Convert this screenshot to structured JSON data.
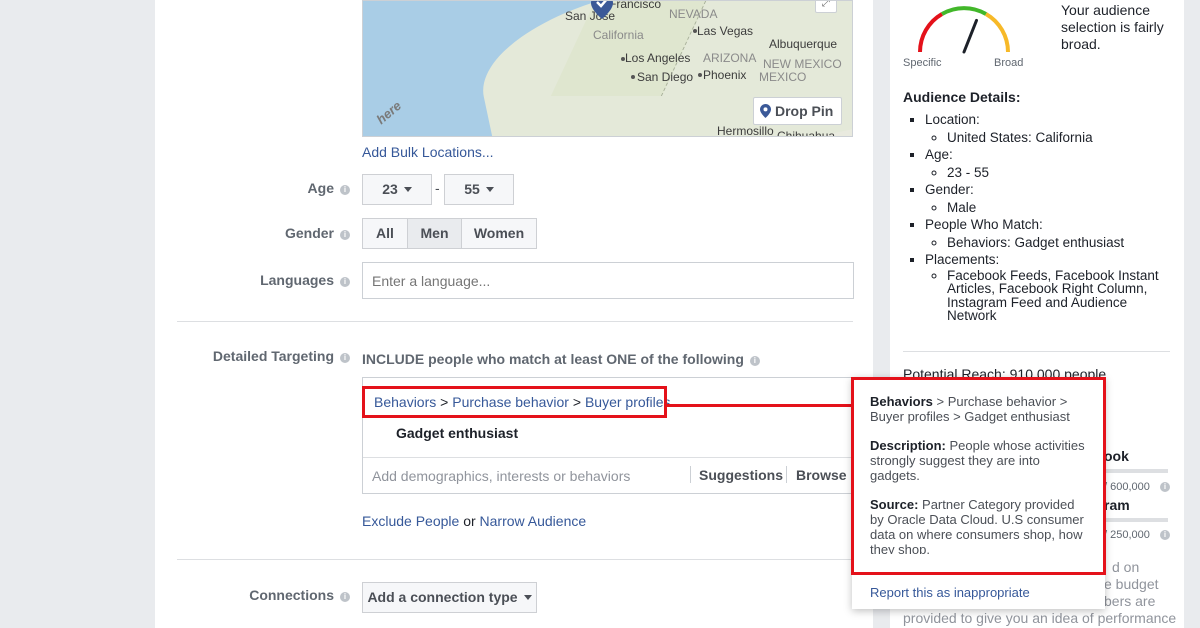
{
  "map": {
    "labels": {
      "san_jose": "San Jose",
      "francisco": "Francisco",
      "nevada": "NEVADA",
      "las_vegas": "Las Vegas",
      "california": "California",
      "arizona": "ARIZONA",
      "los_angeles": "Los Angeles",
      "albuquerque": "Albuquerque",
      "new_mexico": "NEW MEXICO",
      "san_diego": "San Diego",
      "phoenix": "Phoenix",
      "mexico": "MEXICO",
      "hermosillo": "Hermosillo",
      "chihuahua": "Chihuahua",
      "here": "here"
    },
    "drop_pin": "Drop Pin"
  },
  "add_bulk_locations": "Add Bulk Locations...",
  "age": {
    "label": "Age",
    "min": "23",
    "separator": "-",
    "max": "55"
  },
  "gender": {
    "label": "Gender",
    "options": [
      "All",
      "Men",
      "Women"
    ],
    "selected": "Men"
  },
  "languages": {
    "label": "Languages",
    "placeholder": "Enter a language..."
  },
  "detailed_targeting": {
    "label": "Detailed Targeting",
    "include_text": "INCLUDE people who match at least ONE of the following",
    "breadcrumb": [
      "Behaviors",
      "Purchase behavior",
      "Buyer profiles"
    ],
    "breadcrumb_sep": ">",
    "selected_item": "Gadget enthusiast",
    "search_placeholder": "Add demographics, interests or behaviors",
    "suggestions": "Suggestions",
    "browse": "Browse",
    "exclude": "Exclude People",
    "or": "or",
    "narrow": "Narrow Audience"
  },
  "connections": {
    "label": "Connections",
    "button": "Add a connection type"
  },
  "tooltip": {
    "path_bold": "Behaviors",
    "path_rest": " > Purchase behavior > Buyer profiles > Gadget enthusiast",
    "desc_label": "Description:",
    "desc_text": " People whose activities strongly suggest they are into gadgets.",
    "source_label": "Source:",
    "source_text": " Partner Category provided by Oracle Data Cloud. U.S consumer data on where consumers shop, how they shop.",
    "report": "Report this as inappropriate"
  },
  "audience": {
    "gauge_specific": "Specific",
    "gauge_broad": "Broad",
    "gauge_level": 0.62,
    "gauge_colors": [
      "#e4111a",
      "#f7b928",
      "#42b72a"
    ],
    "message": "Your audience selection is fairly broad.",
    "details_title": "Audience Details:",
    "details": [
      {
        "label": "Location:",
        "items": [
          "United States: California"
        ]
      },
      {
        "label": "Age:",
        "items": [
          "23 - 55"
        ]
      },
      {
        "label": "Gender:",
        "items": [
          "Male"
        ]
      },
      {
        "label": "People Who Match:",
        "items": [
          "Behaviors: Gadget enthusiast"
        ]
      },
      {
        "label": "Placements:",
        "items": [
          "Facebook Feeds, Facebook Instant Articles, Facebook Right Column, Instagram Feed and Audience Network"
        ]
      }
    ],
    "potential_reach": "Potential Reach: 910,000 people",
    "fb_title_tail": "ook",
    "fb_count": "/ 600,000",
    "ig_title_tail": "ram",
    "ig_count": "/ 250,000",
    "bottom_lines": [
      "d on",
      "e budget",
      "bers are",
      "provided to give you an idea of performance"
    ]
  }
}
